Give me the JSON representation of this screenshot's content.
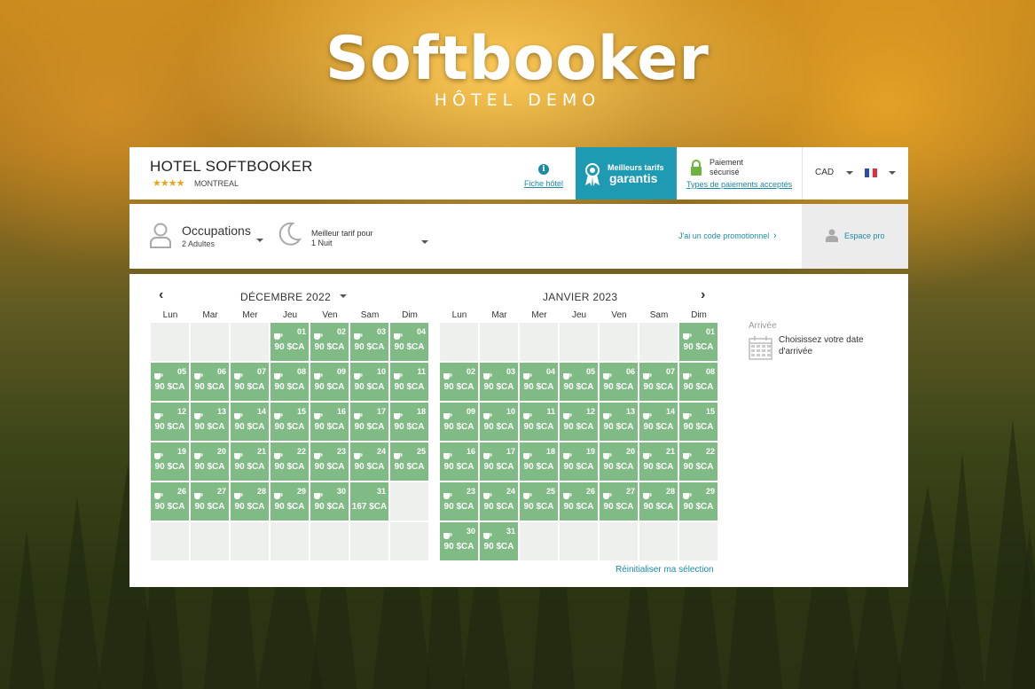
{
  "logo": {
    "brand": "Softbooker",
    "subtitle": "HÔTEL DEMO"
  },
  "hotel": {
    "name": "HOTEL SOFTBOOKER",
    "stars": "★★★★",
    "city": "MONTREAL",
    "fiche_label": "Fiche hôtel",
    "best_rates_line1": "Meilleurs tarifs",
    "best_rates_line2": "garantis",
    "secure_line1": "Paiement",
    "secure_line2": "sécurisé",
    "payment_types_link": "Types de paiements acceptés",
    "currency": "CAD"
  },
  "search": {
    "occupations_label": "Occupations",
    "occupations_value": "2 Adultes",
    "best_rate_label": "Meilleur tarif pour",
    "nights_value": "1 Nuit",
    "promo_link": "J'ai un code promotionnel",
    "espace_pro": "Espace pro"
  },
  "calendar": {
    "weekdays": [
      "Lun",
      "Mar",
      "Mer",
      "Jeu",
      "Ven",
      "Sam",
      "Dim"
    ],
    "months": [
      {
        "title": "DÉCEMBRE 2022",
        "leading_blanks": 3,
        "total_cells": 42,
        "days": [
          {
            "day": "01",
            "price": "90 $CA"
          },
          {
            "day": "02",
            "price": "90 $CA"
          },
          {
            "day": "03",
            "price": "90 $CA"
          },
          {
            "day": "04",
            "price": "90 $CA"
          },
          {
            "day": "05",
            "price": "90 $CA"
          },
          {
            "day": "06",
            "price": "90 $CA"
          },
          {
            "day": "07",
            "price": "90 $CA"
          },
          {
            "day": "08",
            "price": "90 $CA"
          },
          {
            "day": "09",
            "price": "90 $CA"
          },
          {
            "day": "10",
            "price": "90 $CA"
          },
          {
            "day": "11",
            "price": "90 $CA"
          },
          {
            "day": "12",
            "price": "90 $CA"
          },
          {
            "day": "13",
            "price": "90 $CA"
          },
          {
            "day": "14",
            "price": "90 $CA"
          },
          {
            "day": "15",
            "price": "90 $CA"
          },
          {
            "day": "16",
            "price": "90 $CA"
          },
          {
            "day": "17",
            "price": "90 $CA"
          },
          {
            "day": "18",
            "price": "90 $CA"
          },
          {
            "day": "19",
            "price": "90 $CA"
          },
          {
            "day": "20",
            "price": "90 $CA"
          },
          {
            "day": "21",
            "price": "90 $CA"
          },
          {
            "day": "22",
            "price": "90 $CA"
          },
          {
            "day": "23",
            "price": "90 $CA"
          },
          {
            "day": "24",
            "price": "90 $CA"
          },
          {
            "day": "25",
            "price": "90 $CA"
          },
          {
            "day": "26",
            "price": "90 $CA"
          },
          {
            "day": "27",
            "price": "90 $CA"
          },
          {
            "day": "28",
            "price": "90 $CA"
          },
          {
            "day": "29",
            "price": "90 $CA"
          },
          {
            "day": "30",
            "price": "90 $CA"
          },
          {
            "day": "31",
            "price": "167 $CA",
            "no_icon": true
          }
        ]
      },
      {
        "title": "JANVIER 2023",
        "leading_blanks": 6,
        "total_cells": 42,
        "days": [
          {
            "day": "01",
            "price": "90 $CA"
          },
          {
            "day": "02",
            "price": "90 $CA"
          },
          {
            "day": "03",
            "price": "90 $CA"
          },
          {
            "day": "04",
            "price": "90 $CA"
          },
          {
            "day": "05",
            "price": "90 $CA"
          },
          {
            "day": "06",
            "price": "90 $CA"
          },
          {
            "day": "07",
            "price": "90 $CA"
          },
          {
            "day": "08",
            "price": "90 $CA"
          },
          {
            "day": "09",
            "price": "90 $CA"
          },
          {
            "day": "10",
            "price": "90 $CA"
          },
          {
            "day": "11",
            "price": "90 $CA"
          },
          {
            "day": "12",
            "price": "90 $CA"
          },
          {
            "day": "13",
            "price": "90 $CA"
          },
          {
            "day": "14",
            "price": "90 $CA"
          },
          {
            "day": "15",
            "price": "90 $CA"
          },
          {
            "day": "16",
            "price": "90 $CA"
          },
          {
            "day": "17",
            "price": "90 $CA"
          },
          {
            "day": "18",
            "price": "90 $CA"
          },
          {
            "day": "19",
            "price": "90 $CA"
          },
          {
            "day": "20",
            "price": "90 $CA"
          },
          {
            "day": "21",
            "price": "90 $CA"
          },
          {
            "day": "22",
            "price": "90 $CA"
          },
          {
            "day": "23",
            "price": "90 $CA"
          },
          {
            "day": "24",
            "price": "90 $CA"
          },
          {
            "day": "25",
            "price": "90 $CA"
          },
          {
            "day": "26",
            "price": "90 $CA"
          },
          {
            "day": "27",
            "price": "90 $CA"
          },
          {
            "day": "28",
            "price": "90 $CA"
          },
          {
            "day": "29",
            "price": "90 $CA"
          },
          {
            "day": "30",
            "price": "90 $CA"
          },
          {
            "day": "31",
            "price": "90 $CA"
          }
        ]
      }
    ],
    "reset_link": "Réinitialiser ma sélection",
    "arrival_label": "Arrivée",
    "arrival_help": "Choisissez votre date d'arrivée"
  },
  "colors": {
    "accent": "#1f9ab3",
    "available_day": "#80bb86",
    "empty_day": "#eef0ee",
    "star": "#e8a51a"
  },
  "icons": [
    "info-icon",
    "medal-icon",
    "lock-icon",
    "chevron-down-icon",
    "flag-icon",
    "person-icon",
    "moon-icon",
    "chevron-right-icon",
    "chevron-left-icon",
    "cup-icon",
    "calendar-icon"
  ]
}
